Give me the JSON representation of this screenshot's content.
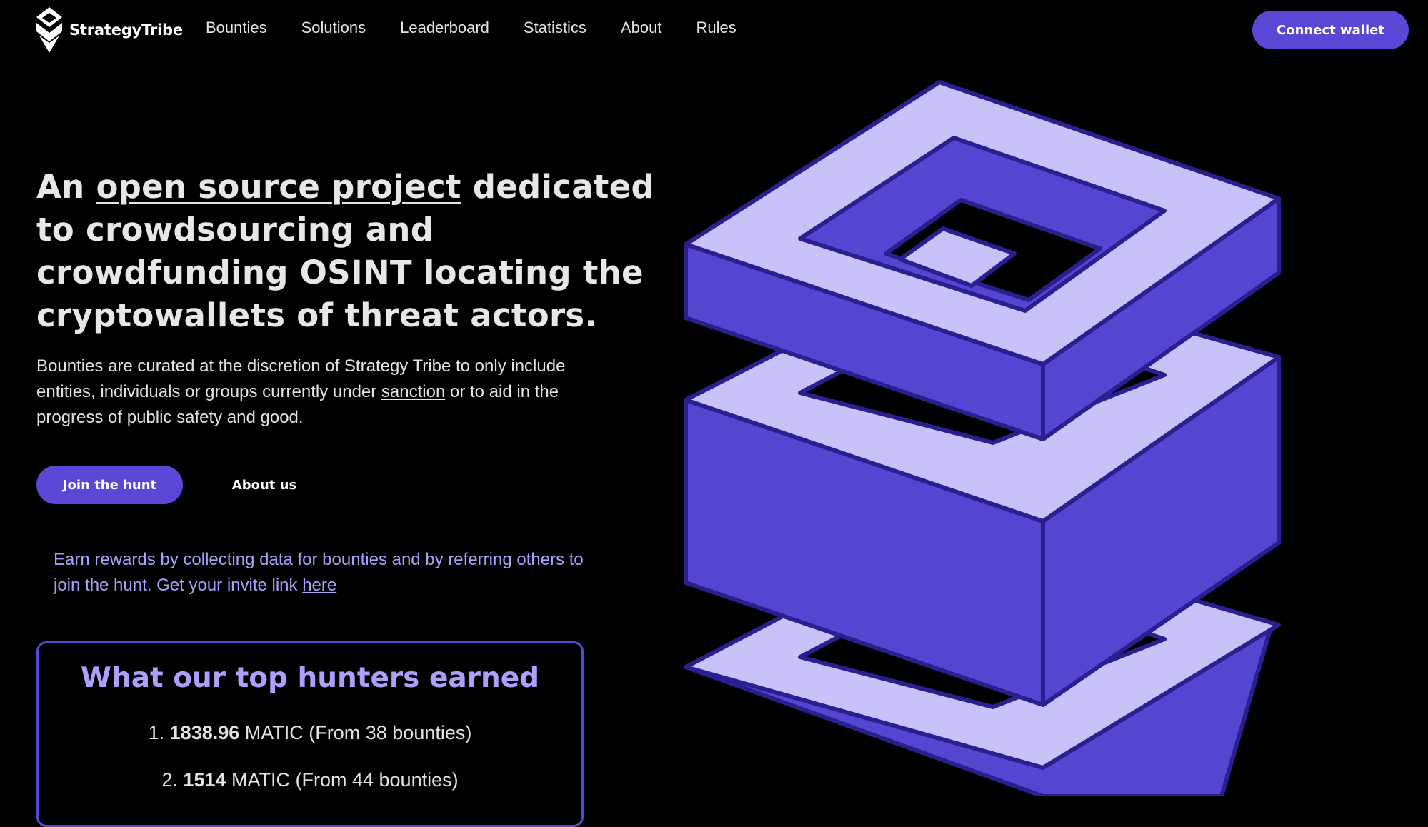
{
  "brand": {
    "name": "StrategyTribe"
  },
  "nav": {
    "links": [
      "Bounties",
      "Solutions",
      "Leaderboard",
      "Statistics",
      "About",
      "Rules"
    ],
    "connect_label": "Connect wallet"
  },
  "hero": {
    "title_pre": "An ",
    "title_link": "open source project",
    "title_post": " dedicated to crowdsourcing and crowdfunding OSINT locating the cryptowallets of threat actors.",
    "desc_pre": "Bounties are curated at the discretion of Strategy Tribe to only include entities, individuals or groups currently under ",
    "desc_link": "sanction",
    "desc_post": " or to aid in the progress of public safety and good.",
    "join_label": "Join the hunt",
    "about_label": "About us",
    "earn_pre": "Earn rewards by collecting data for bounties and by referring others to join the hunt. Get your invite link ",
    "earn_link": "here"
  },
  "top_hunters": {
    "title": "What our top hunters earned",
    "rows": [
      {
        "rank": "1.",
        "amount": "1838.96",
        "rest": "MATIC (From 38 bounties)"
      },
      {
        "rank": "2.",
        "amount": "1514",
        "rest": "MATIC (From 44 bounties)"
      }
    ]
  },
  "colors": {
    "background": "#000000",
    "accent": "#5a47d6",
    "accent_light": "#ad9ffb",
    "face_light": "#c9c2f9",
    "face_dark": "#5546d2"
  },
  "icons": {
    "logo": "strategytribe-logo-icon",
    "illustration": "stacked-cubes-illustration"
  }
}
